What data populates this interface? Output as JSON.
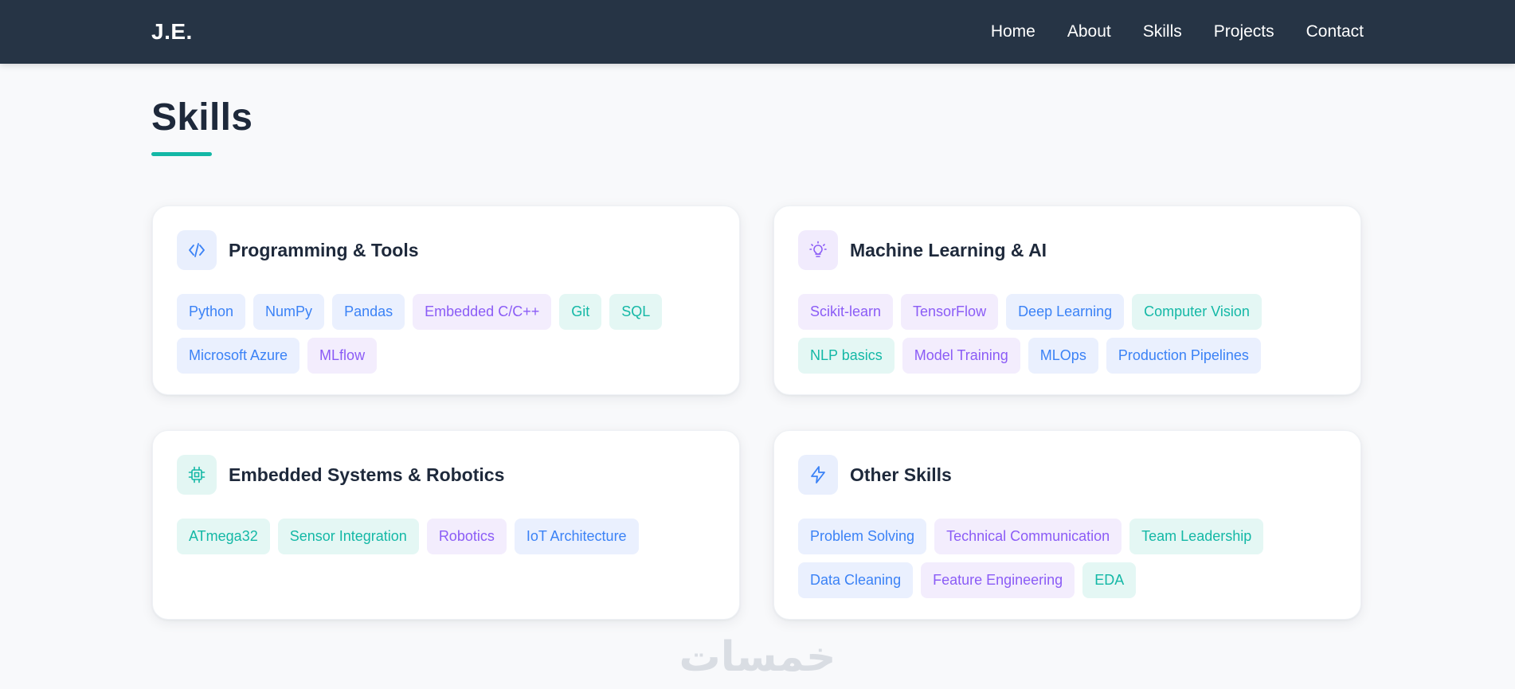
{
  "nav": {
    "brand": "J.E.",
    "links": [
      "Home",
      "About",
      "Skills",
      "Projects",
      "Contact"
    ]
  },
  "section": {
    "title": "Skills"
  },
  "colors": {
    "navbar": "#263445",
    "accent": "#14b8a6",
    "blue": "#3b82f6",
    "purple": "#8b5cf6",
    "teal": "#14b8a6"
  },
  "cards": [
    {
      "title": "Programming & Tools",
      "icon": "code-icon",
      "tags": [
        {
          "label": "Python",
          "color": "blue"
        },
        {
          "label": "NumPy",
          "color": "blue"
        },
        {
          "label": "Pandas",
          "color": "blue"
        },
        {
          "label": "Embedded C/C++",
          "color": "purple"
        },
        {
          "label": "Git",
          "color": "teal"
        },
        {
          "label": "SQL",
          "color": "teal"
        },
        {
          "label": "Microsoft Azure",
          "color": "blue"
        },
        {
          "label": "MLflow",
          "color": "purple"
        }
      ]
    },
    {
      "title": "Machine Learning & AI",
      "icon": "lightbulb-icon",
      "tags": [
        {
          "label": "Scikit-learn",
          "color": "purple"
        },
        {
          "label": "TensorFlow",
          "color": "purple"
        },
        {
          "label": "Deep Learning",
          "color": "blue"
        },
        {
          "label": "Computer Vision",
          "color": "teal"
        },
        {
          "label": "NLP basics",
          "color": "teal"
        },
        {
          "label": "Model Training",
          "color": "purple"
        },
        {
          "label": "MLOps",
          "color": "blue"
        },
        {
          "label": "Production Pipelines",
          "color": "blue"
        }
      ]
    },
    {
      "title": "Embedded Systems & Robotics",
      "icon": "cpu-chip-icon",
      "tags": [
        {
          "label": "ATmega32",
          "color": "teal"
        },
        {
          "label": "Sensor Integration",
          "color": "teal"
        },
        {
          "label": "Robotics",
          "color": "purple"
        },
        {
          "label": "IoT Architecture",
          "color": "blue"
        }
      ]
    },
    {
      "title": "Other Skills",
      "icon": "lightning-bolt-icon",
      "tags": [
        {
          "label": "Problem Solving",
          "color": "blue"
        },
        {
          "label": "Technical Communication",
          "color": "purple"
        },
        {
          "label": "Team Leadership",
          "color": "teal"
        },
        {
          "label": "Data Cleaning",
          "color": "blue"
        },
        {
          "label": "Feature Engineering",
          "color": "purple"
        },
        {
          "label": "EDA",
          "color": "teal"
        }
      ]
    }
  ],
  "watermark": {
    "text": "خمسات"
  }
}
